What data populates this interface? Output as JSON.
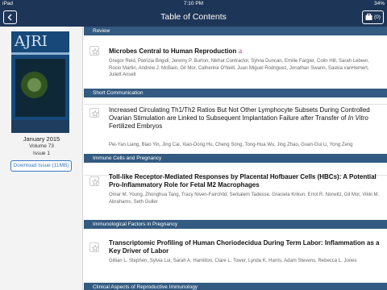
{
  "status_bar": {
    "carrier": "iPad",
    "time": "7:10 PM",
    "battery": "34%"
  },
  "nav": {
    "title": "Table of Contents",
    "cart_count": "(0)",
    "back_icon": "chevron-left-icon",
    "cart_icon": "cart-icon"
  },
  "issue": {
    "journal_cover_title": "AJRI",
    "date": "January 2015",
    "volume": "Volume 73",
    "issue": "Issue 1",
    "download_label": "Download Issue (11MB)"
  },
  "sections": [
    {
      "header": "Review",
      "articles": [
        {
          "title": "Microbes Central to Human Reproduction",
          "open_access_icon": "open-access-icon",
          "authors": "Gregor Reid, Patrizia Brigidi, Jeremy P. Burton, Nikhat Contractor, Sylvia Duncan, Emilie Fargier, Colin Hill, Sarah Lebeer, Rocio Martin, Andrew J. McBain, Gil Mor, Catherine O'Neill, Juan Miguel Rodriguez, Jonathan Swann, Saskia vanHemert, Juliett Ansell"
        }
      ]
    },
    {
      "header": "Short Communication",
      "articles": [
        {
          "title": "Increased Circulating Th1/Th2 Ratios But Not Other Lymphocyte Subsets During Controlled Ovarian Stimulation are Linked to Subsequent Implantation Failure after Transfer of",
          "title_italic": "In Vitro",
          "title_end": "Fertilized Embryos",
          "authors": "Pei-Yan Liang, Biao Yin, Jing Cai, Xiao-Dong Hu, Cheng Song, Tong-Hua Wu, Jing Zhao, Guan-Gui Li, Yong Zeng"
        }
      ]
    },
    {
      "header": "Immune Cells and Pregnancy",
      "articles": [
        {
          "title": "Toll-like Receptor-Mediated Responses by Placental Hofbauer Cells (HBCs): A Potential Pro-Inflammatory Role for Fetal M2 Macrophages",
          "authors": "Omar M. Young, Zhonghua Tang, Tracy Niven-Fairchild, Serkalem Tadesse, Graciela Krikun, Errol R. Norwitz, Gil Mor, Vikki M. Abrahams, Seth Guller"
        }
      ]
    },
    {
      "header": "Immunological Factors in Pregnancy",
      "articles": [
        {
          "title": "Transcriptomic Profiling of Human Choriodecidua During Term Labor: Inflammation as a Key Driver of Labor",
          "authors": "Gillian L. Stephen, Sylvia Lui, Sarah A. Hamilton, Clare L. Tower, Lynda K. Harris, Adam Stevens, Rebecca L. Jones"
        }
      ]
    },
    {
      "header": "Clinical Aspects of Reproductive Immunology",
      "articles": []
    }
  ],
  "colors": {
    "nav_bg": "#1d3557",
    "section_header_bg": "#335a80",
    "accent_blue": "#3a78c2"
  }
}
